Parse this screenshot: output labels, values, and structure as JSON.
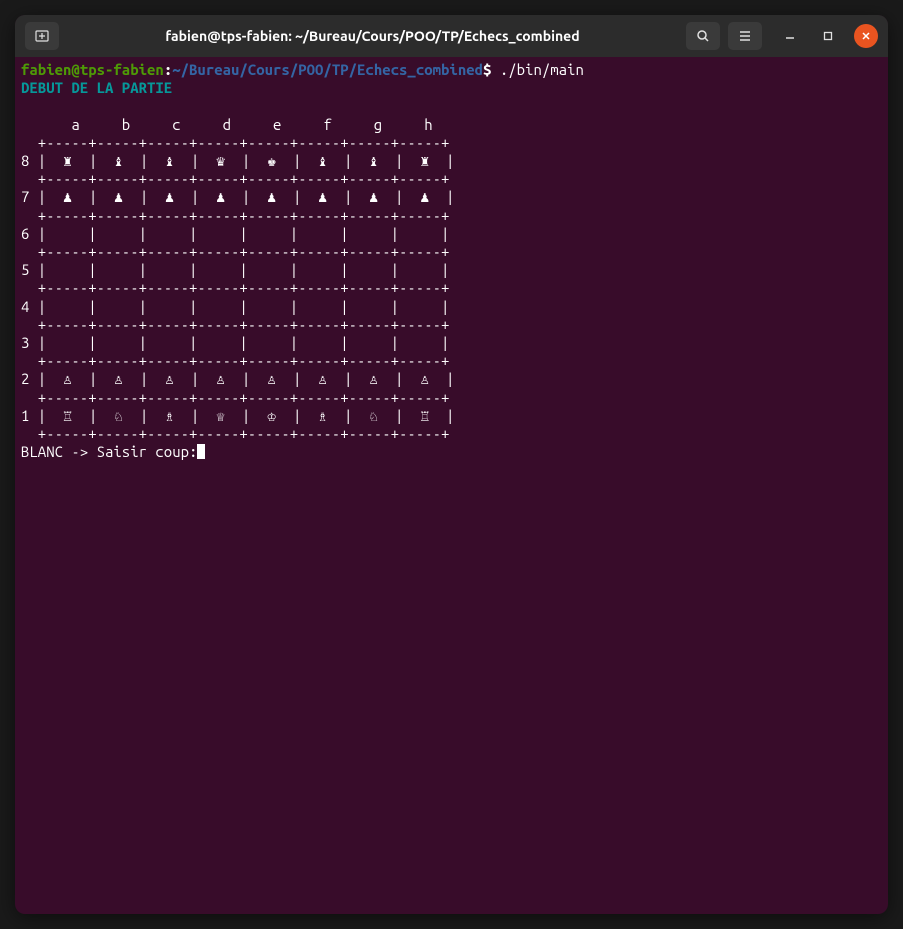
{
  "window": {
    "title": "fabien@tps-fabien: ~/Bureau/Cours/POO/TP/Echecs_combined"
  },
  "prompt": {
    "user": "fabien@tps-fabien",
    "sep1": ":",
    "path": "~/Bureau/Cours/POO/TP/Echecs_combined",
    "sep2": "$",
    "command": "./bin/main"
  },
  "game": {
    "start_msg": "DEBUT DE LA PARTIE",
    "input_prompt": "BLANC -> Saisir coup:"
  },
  "board": {
    "columns": [
      "a",
      "b",
      "c",
      "d",
      "e",
      "f",
      "g",
      "h"
    ],
    "rows": [
      "8",
      "7",
      "6",
      "5",
      "4",
      "3",
      "2",
      "1"
    ],
    "divider": "  +-----+-----+-----+-----+-----+-----+-----+-----+",
    "header": "      a     b     c     d     e     f     g     h   ",
    "cells": {
      "8": [
        "♜",
        "♝",
        "♝",
        "♛",
        "♚",
        "♝",
        "♝",
        "♜"
      ],
      "7": [
        "♟",
        "♟",
        "♟",
        "♟",
        "♟",
        "♟",
        "♟",
        "♟"
      ],
      "6": [
        " ",
        " ",
        " ",
        " ",
        " ",
        " ",
        " ",
        " "
      ],
      "5": [
        " ",
        " ",
        " ",
        " ",
        " ",
        " ",
        " ",
        " "
      ],
      "4": [
        " ",
        " ",
        " ",
        " ",
        " ",
        " ",
        " ",
        " "
      ],
      "3": [
        " ",
        " ",
        " ",
        " ",
        " ",
        " ",
        " ",
        " "
      ],
      "2": [
        "♙",
        "♙",
        "♙",
        "♙",
        "♙",
        "♙",
        "♙",
        "♙"
      ],
      "1": [
        "♖",
        "♘",
        "♗",
        "♕",
        "♔",
        "♗",
        "♘",
        "♖"
      ]
    }
  }
}
